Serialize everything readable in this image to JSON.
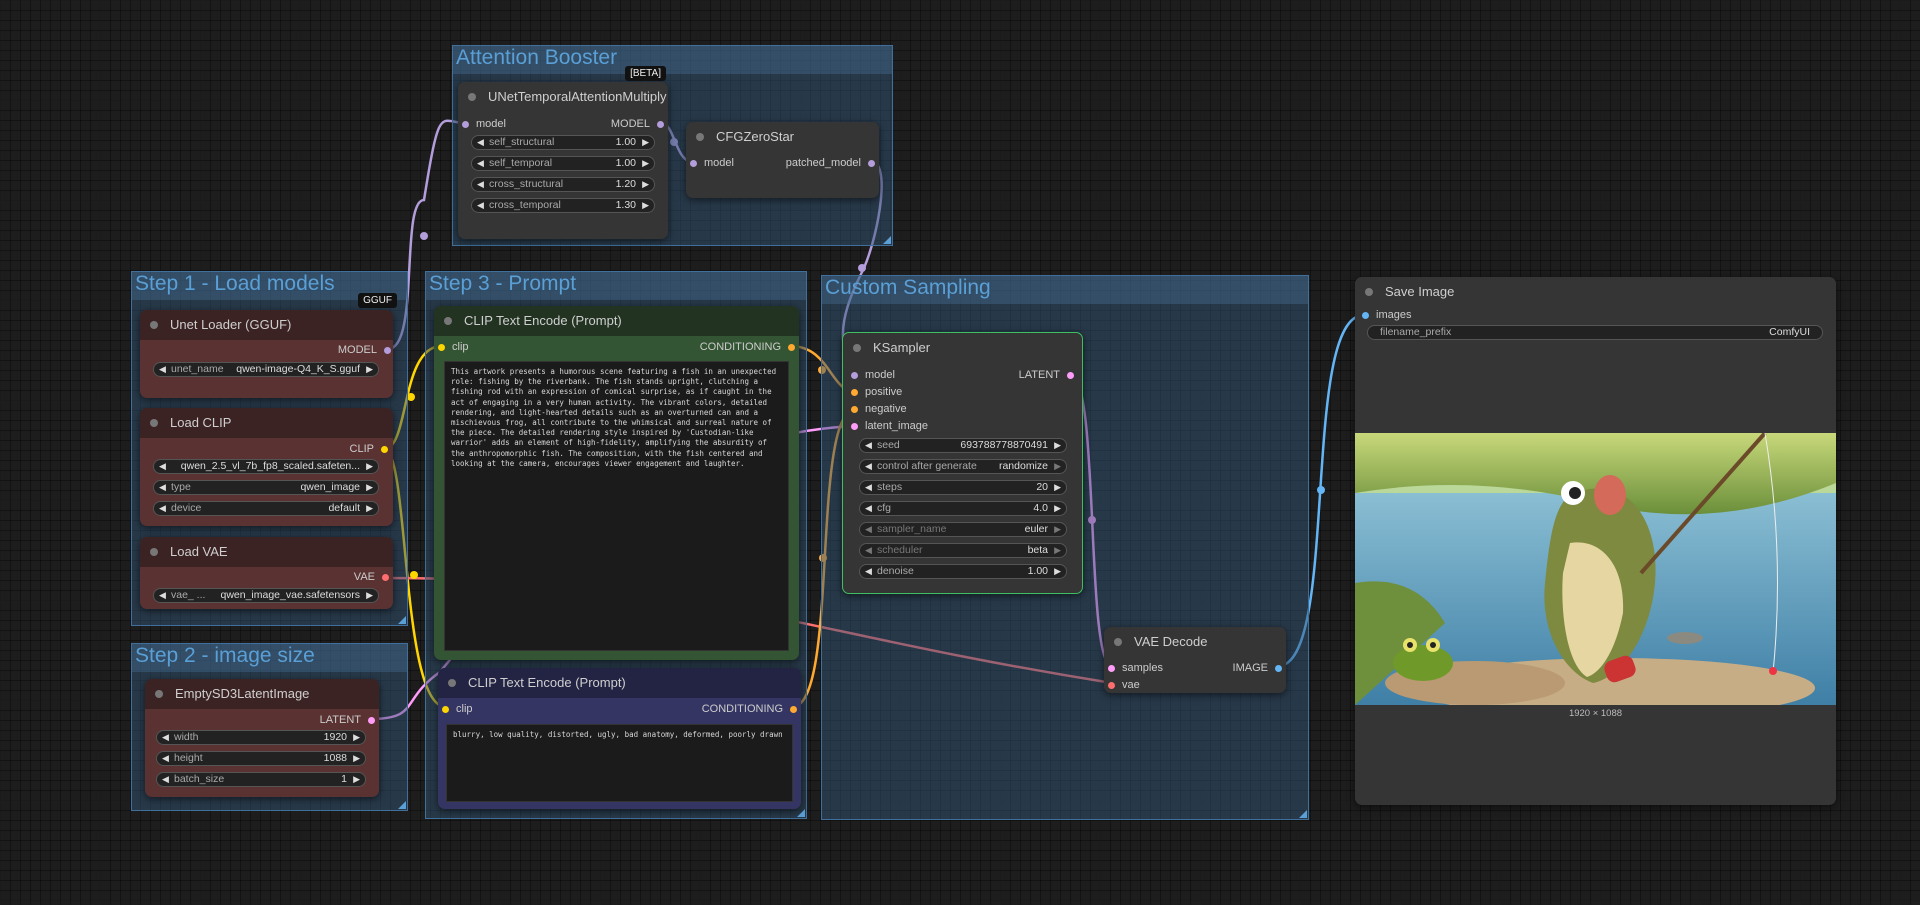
{
  "groups": {
    "attention_booster": "Attention Booster",
    "load_models": "Step 1 - Load models",
    "prompt": "Step 3 - Prompt",
    "custom_sampling": "Custom Sampling",
    "image_size": "Step 2 - image size"
  },
  "badges": {
    "beta": "[BETA]",
    "gguf": "GGUF"
  },
  "nodes": {
    "unet_temporal": {
      "title": "UNetTemporalAttentionMultiply",
      "input": "model",
      "output": "MODEL",
      "widgets": [
        {
          "label": "self_structural",
          "value": "1.00"
        },
        {
          "label": "self_temporal",
          "value": "1.00"
        },
        {
          "label": "cross_structural",
          "value": "1.20"
        },
        {
          "label": "cross_temporal",
          "value": "1.30"
        }
      ]
    },
    "cfg_zero_star": {
      "title": "CFGZeroStar",
      "input": "model",
      "output": "patched_model"
    },
    "unet_loader": {
      "title": "Unet Loader (GGUF)",
      "output": "MODEL",
      "widget": {
        "label": "unet_name",
        "value": "qwen-image-Q4_K_S.gguf"
      }
    },
    "load_clip": {
      "title": "Load CLIP",
      "output": "CLIP",
      "widgets": [
        {
          "label": "",
          "value": "qwen_2.5_vl_7b_fp8_scaled.safeten..."
        },
        {
          "label": "type",
          "value": "qwen_image"
        },
        {
          "label": "device",
          "value": "default"
        }
      ]
    },
    "load_vae": {
      "title": "Load VAE",
      "output": "VAE",
      "widget": {
        "label": "vae_ ...",
        "value": "qwen_image_vae.safetensors"
      }
    },
    "empty_latent": {
      "title": "EmptySD3LatentImage",
      "output": "LATENT",
      "widgets": [
        {
          "label": "width",
          "value": "1920"
        },
        {
          "label": "height",
          "value": "1088"
        },
        {
          "label": "batch_size",
          "value": "1"
        }
      ]
    },
    "clip_pos": {
      "title": "CLIP Text Encode (Prompt)",
      "input": "clip",
      "output": "CONDITIONING",
      "text": "This artwork presents a humorous scene featuring a fish in an unexpected role: fishing by the riverbank. The fish stands upright, clutching a fishing rod with an expression of comical surprise, as if caught in the act of engaging in a very human activity. The vibrant colors, detailed rendering, and light-hearted details such as an overturned can and a mischievous frog, all contribute to the whimsical and surreal nature of the piece. The detailed rendering style inspired by 'Custodian-like warrior' adds an element of high-fidelity, amplifying the absurdity of the anthropomorphic fish. The composition, with the fish centered and looking at the camera, encourages viewer engagement and laughter."
    },
    "clip_neg": {
      "title": "CLIP Text Encode (Prompt)",
      "input": "clip",
      "output": "CONDITIONING",
      "text": "blurry, low quality, distorted, ugly, bad anatomy, deformed, poorly drawn"
    },
    "ksampler": {
      "title": "KSampler",
      "inputs": [
        "model",
        "positive",
        "negative",
        "latent_image"
      ],
      "output": "LATENT",
      "widgets": [
        {
          "label": "seed",
          "value": "693788778870491"
        },
        {
          "label": "control after generate",
          "value": "randomize"
        },
        {
          "label": "steps",
          "value": "20"
        },
        {
          "label": "cfg",
          "value": "4.0"
        },
        {
          "label": "sampler_name",
          "value": "euler"
        },
        {
          "label": "scheduler",
          "value": "beta"
        },
        {
          "label": "denoise",
          "value": "1.00"
        }
      ]
    },
    "vae_decode": {
      "title": "VAE Decode",
      "inputs": [
        "samples",
        "vae"
      ],
      "output": "IMAGE"
    },
    "save_image": {
      "title": "Save Image",
      "input": "images",
      "widget": {
        "label": "filename_prefix",
        "value": "ComfyUI"
      },
      "image_caption": "1920 × 1088"
    }
  },
  "colors": {
    "model": "#b39ddb",
    "clip": "#ffd500",
    "vae": "#ff6e6e",
    "conditioning": "#ffa931",
    "latent": "#ff9cf9",
    "image": "#64b5f6"
  }
}
